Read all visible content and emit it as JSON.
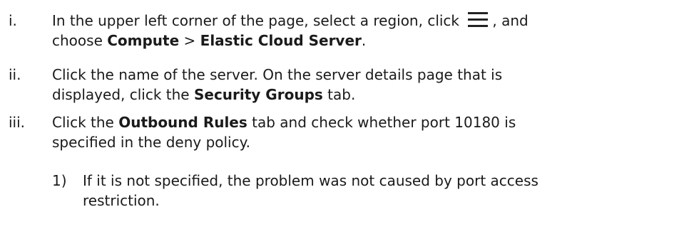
{
  "steps": [
    {
      "marker": "i.",
      "line1_a": "In the upper left corner of the page, select a region, click ",
      "menu_icon": "menu-icon",
      "line1_b": ", and",
      "line2_a": "choose ",
      "compute": "Compute",
      "sep": " > ",
      "ecs": "Elastic Cloud Server",
      "line2_end": "."
    },
    {
      "marker": "ii.",
      "line1": "Click the name of the server. On the server details page that is",
      "line2_a": "displayed, click the ",
      "security_groups": "Security Groups",
      "line2_b": " tab."
    },
    {
      "marker": "iii.",
      "line1_a": "Click the ",
      "outbound_rules": "Outbound Rules",
      "line1_b": " tab and check whether port 10180 is",
      "line2": "specified in the deny policy."
    }
  ],
  "substeps": [
    {
      "marker": "1)",
      "line1": "If it is not specified, the problem was not caused by port access",
      "line2": "restriction."
    }
  ]
}
